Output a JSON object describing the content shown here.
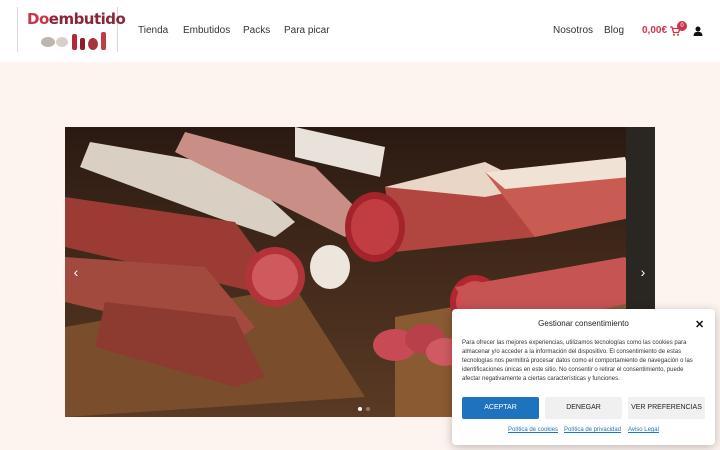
{
  "brand": {
    "logo_prefix": "Do",
    "logo_suffix": "embutido"
  },
  "nav": {
    "items": [
      "Tienda",
      "Embutidos",
      "Packs",
      "Para picar",
      "Nosotros",
      "Blog"
    ],
    "cart_total": "0,00€",
    "cart_count": "0"
  },
  "slider": {
    "prev_label": "‹",
    "next_label": "›"
  },
  "consent": {
    "title": "Gestionar consentimiento",
    "close_label": "✕",
    "body": "Para ofrecer las mejores experiencias, utilizamos tecnologías como las cookies para almacenar y/o acceder a la información del dispositivo. El consentimiento de estas tecnologías nos permitirá procesar datos como el comportamiento de navegación o las identificaciones únicas en este sitio. No consentir o retirar el consentimiento, puede afectar negativamente a ciertas características y funciones.",
    "accept": "ACEPTAR",
    "deny": "DENEGAR",
    "preferences": "VER PREFERENCIAS",
    "links": [
      "Política de cookies",
      "Política de privacidad",
      "Aviso Legal"
    ]
  },
  "colors": {
    "brand": "#c9344a",
    "accept": "#1e73be",
    "background": "#fdf3ef"
  }
}
